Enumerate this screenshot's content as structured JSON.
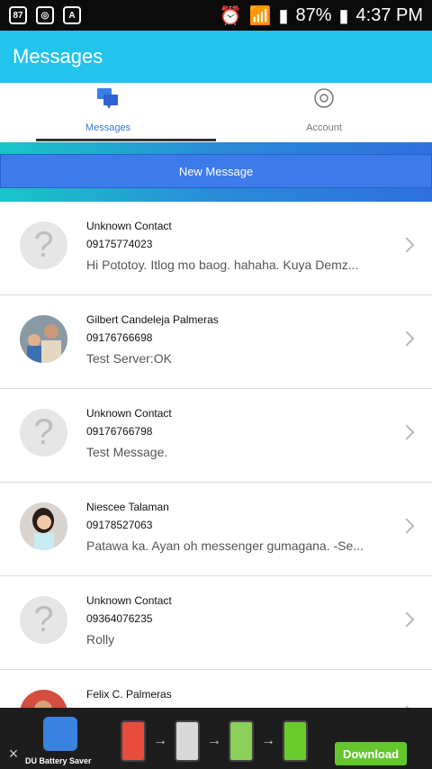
{
  "status_bar": {
    "left_icons": [
      "notification-icon",
      "app-icon",
      "a-icon"
    ],
    "battery": "87%",
    "time": "4:37 PM",
    "right_icons": [
      "alarm-icon",
      "wifi-icon",
      "signal-icon",
      "battery-icon"
    ]
  },
  "app_bar": {
    "title": "Messages"
  },
  "tabs": [
    {
      "label": "Messages",
      "icon": "chat-bubbles-icon",
      "active": true
    },
    {
      "label": "Account",
      "icon": "gear-icon",
      "active": false
    }
  ],
  "actions": {
    "new_message": "New Message"
  },
  "conversations": [
    {
      "name": "Unknown Contact",
      "number": "09175774023",
      "preview": "Hi Pototoy. Itlog mo baog. hahaha. Kuya Demz...",
      "avatar": "unknown"
    },
    {
      "name": "Gilbert Candeleja Palmeras",
      "number": "09176766698",
      "preview": "Test Server:OK",
      "avatar": "photo"
    },
    {
      "name": "Unknown Contact",
      "number": "09176766798",
      "preview": "Test Message.",
      "avatar": "unknown"
    },
    {
      "name": "Niescee Talaman",
      "number": "09178527063",
      "preview": "Patawa ka. Ayan oh messenger gumagana. -Se...",
      "avatar": "photo"
    },
    {
      "name": "Unknown Contact",
      "number": "09364076235",
      "preview": "Rolly",
      "avatar": "unknown"
    },
    {
      "name": "Felix C. Palmeras",
      "number": "",
      "preview": "",
      "avatar": "photo"
    }
  ],
  "ad": {
    "brand": "DU Battery Saver",
    "cta": "Download",
    "close": "×"
  },
  "colors": {
    "accent": "#22c3ec",
    "primary_blue": "#3d7bea",
    "ad_green": "#63c72b"
  }
}
